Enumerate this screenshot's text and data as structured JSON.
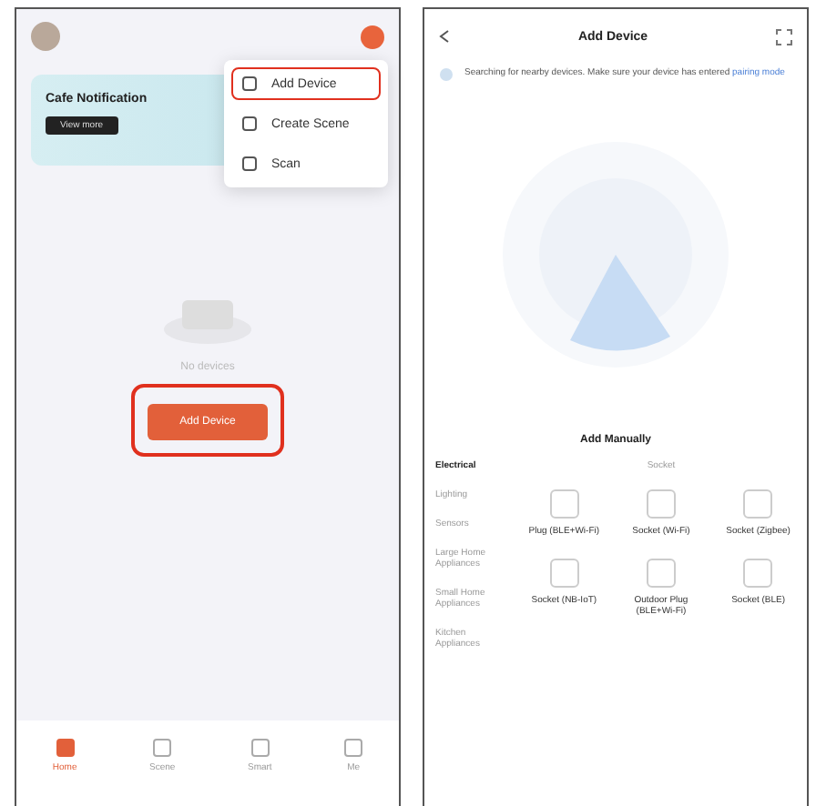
{
  "home_screen": {
    "banner": {
      "title": "Cafe Notification",
      "button": "View more"
    },
    "menu": [
      {
        "label": "Add Device",
        "highlighted": true
      },
      {
        "label": "Create Scene",
        "highlighted": false
      },
      {
        "label": "Scan",
        "highlighted": false
      }
    ],
    "empty_state": {
      "text": "No devices",
      "button": "Add Device",
      "button_highlighted": true
    },
    "tabs": [
      {
        "label": "Home",
        "selected": true
      },
      {
        "label": "Scene",
        "selected": false
      },
      {
        "label": "Smart",
        "selected": false
      },
      {
        "label": "Me",
        "selected": false
      }
    ]
  },
  "add_device_screen": {
    "title": "Add Device",
    "notice": {
      "text": "Searching for nearby devices. Make sure your device has entered",
      "link": "pairing mode"
    },
    "section_title": "Add Manually",
    "categories": [
      {
        "label": "Electrical",
        "selected": true
      },
      {
        "label": "Lighting",
        "selected": false
      },
      {
        "label": "Sensors",
        "selected": false
      },
      {
        "label": "Large Home Appliances",
        "selected": false
      },
      {
        "label": "Small Home Appliances",
        "selected": false
      },
      {
        "label": "Kitchen Appliances",
        "selected": false
      }
    ],
    "group_title": "Socket",
    "devices": [
      {
        "label": "Plug (BLE+Wi-Fi)"
      },
      {
        "label": "Socket (Wi-Fi)"
      },
      {
        "label": "Socket (Zigbee)"
      },
      {
        "label": "Socket (NB-IoT)"
      },
      {
        "label": "Outdoor Plug (BLE+Wi-Fi)"
      },
      {
        "label": "Socket (BLE)"
      }
    ]
  }
}
